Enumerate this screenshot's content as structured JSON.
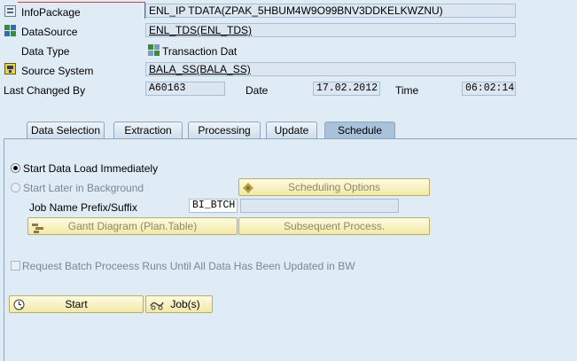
{
  "header": {
    "infopackage": {
      "label": "InfoPackage",
      "value": "ENL_IP TDATA(ZPAK_5HBUM4W9O99BNV3DDKELKWZNU)"
    },
    "datasource": {
      "label": "DataSource",
      "value": "ENL_TDS(ENL_TDS)"
    },
    "data_type": {
      "label": "Data Type",
      "value": "Transaction Dat"
    },
    "source_system": {
      "label": "Source System",
      "value": "BALA_SS(BALA_SS)"
    },
    "last_changed": {
      "label": "Last Changed By",
      "value": "A60163"
    },
    "date": {
      "label": "Date",
      "value": "17.02.2012"
    },
    "time": {
      "label": "Time",
      "value": "06:02:14"
    }
  },
  "tabs": [
    {
      "label": "Data Selection"
    },
    {
      "label": "Extraction"
    },
    {
      "label": "Processing"
    },
    {
      "label": "Update"
    },
    {
      "label": "Schedule"
    }
  ],
  "active_tab": "Schedule",
  "schedule": {
    "option_immediate": "Start Data Load Immediately",
    "option_later": "Start Later in Background",
    "scheduling_options_btn": "Scheduling Options",
    "job_name_label": "Job Name Prefix/Suffix",
    "job_prefix": "BI_BTCH",
    "job_suffix": "",
    "gantt_btn": "Gantt Diagram (Plan.Table)",
    "subsequent_btn": "Subsequent Process.",
    "batch_checkbox_label": "Request Batch Proceess Runs Until All Data Has Been Updated in BW",
    "start_btn": "Start",
    "jobs_btn": "Job(s)"
  },
  "colors": {
    "background": "#dfebf5",
    "button": "#f2e8a8",
    "active_tab": "#a9c2db"
  }
}
